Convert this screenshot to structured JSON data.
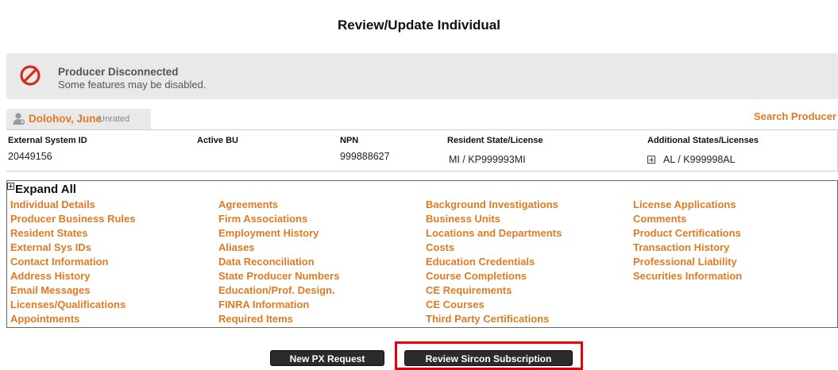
{
  "page": {
    "title": "Review/Update Individual"
  },
  "alert": {
    "icon": "no-entry-icon",
    "title": "Producer Disconnected",
    "message": "Some features may be disabled."
  },
  "producer": {
    "avatar": "person-icon",
    "name": "Dolohov, June",
    "rating": "Unrated"
  },
  "search_producer": "Search Producer",
  "info": {
    "headers": [
      "External System ID",
      "Active BU",
      "NPN",
      "Resident State/License",
      "Additional States/Licenses"
    ],
    "values": {
      "external_system_id": "20449156",
      "active_bu": "",
      "npn": "999888627",
      "resident_state_license": "MI / KP999993MI",
      "additional_states_licenses": "AL / K999998AL"
    }
  },
  "links": {
    "expand_all": "Expand All",
    "col1": [
      "Individual Details",
      "Producer Business Rules",
      "Resident States",
      "External Sys IDs",
      "Contact Information",
      "Address History",
      "Email Messages",
      "Licenses/Qualifications",
      "Appointments"
    ],
    "col2": [
      "Agreements",
      "Firm Associations",
      "Employment History",
      "Aliases",
      "Data Reconciliation",
      "State Producer Numbers",
      "Education/Prof. Design.",
      "FINRA Information",
      "Required Items"
    ],
    "col3": [
      "Background Investigations",
      "Business Units",
      "Locations and Departments",
      "Costs",
      "Education Credentials",
      "Course Completions",
      "CE Requirements",
      "CE Courses",
      "Third Party Certifications"
    ],
    "col4": [
      "License Applications",
      "Comments",
      "Product Certifications",
      "Transaction History",
      "Professional Liability",
      "Securities Information"
    ]
  },
  "buttons": {
    "new_px": "New PX Request",
    "review_sircon": "Review Sircon Subscription"
  },
  "colors": {
    "link": "#e07b24",
    "highlight": "#e8000b",
    "alert_bg": "#e9e9e9",
    "button_bg": "#2b2b2b"
  }
}
